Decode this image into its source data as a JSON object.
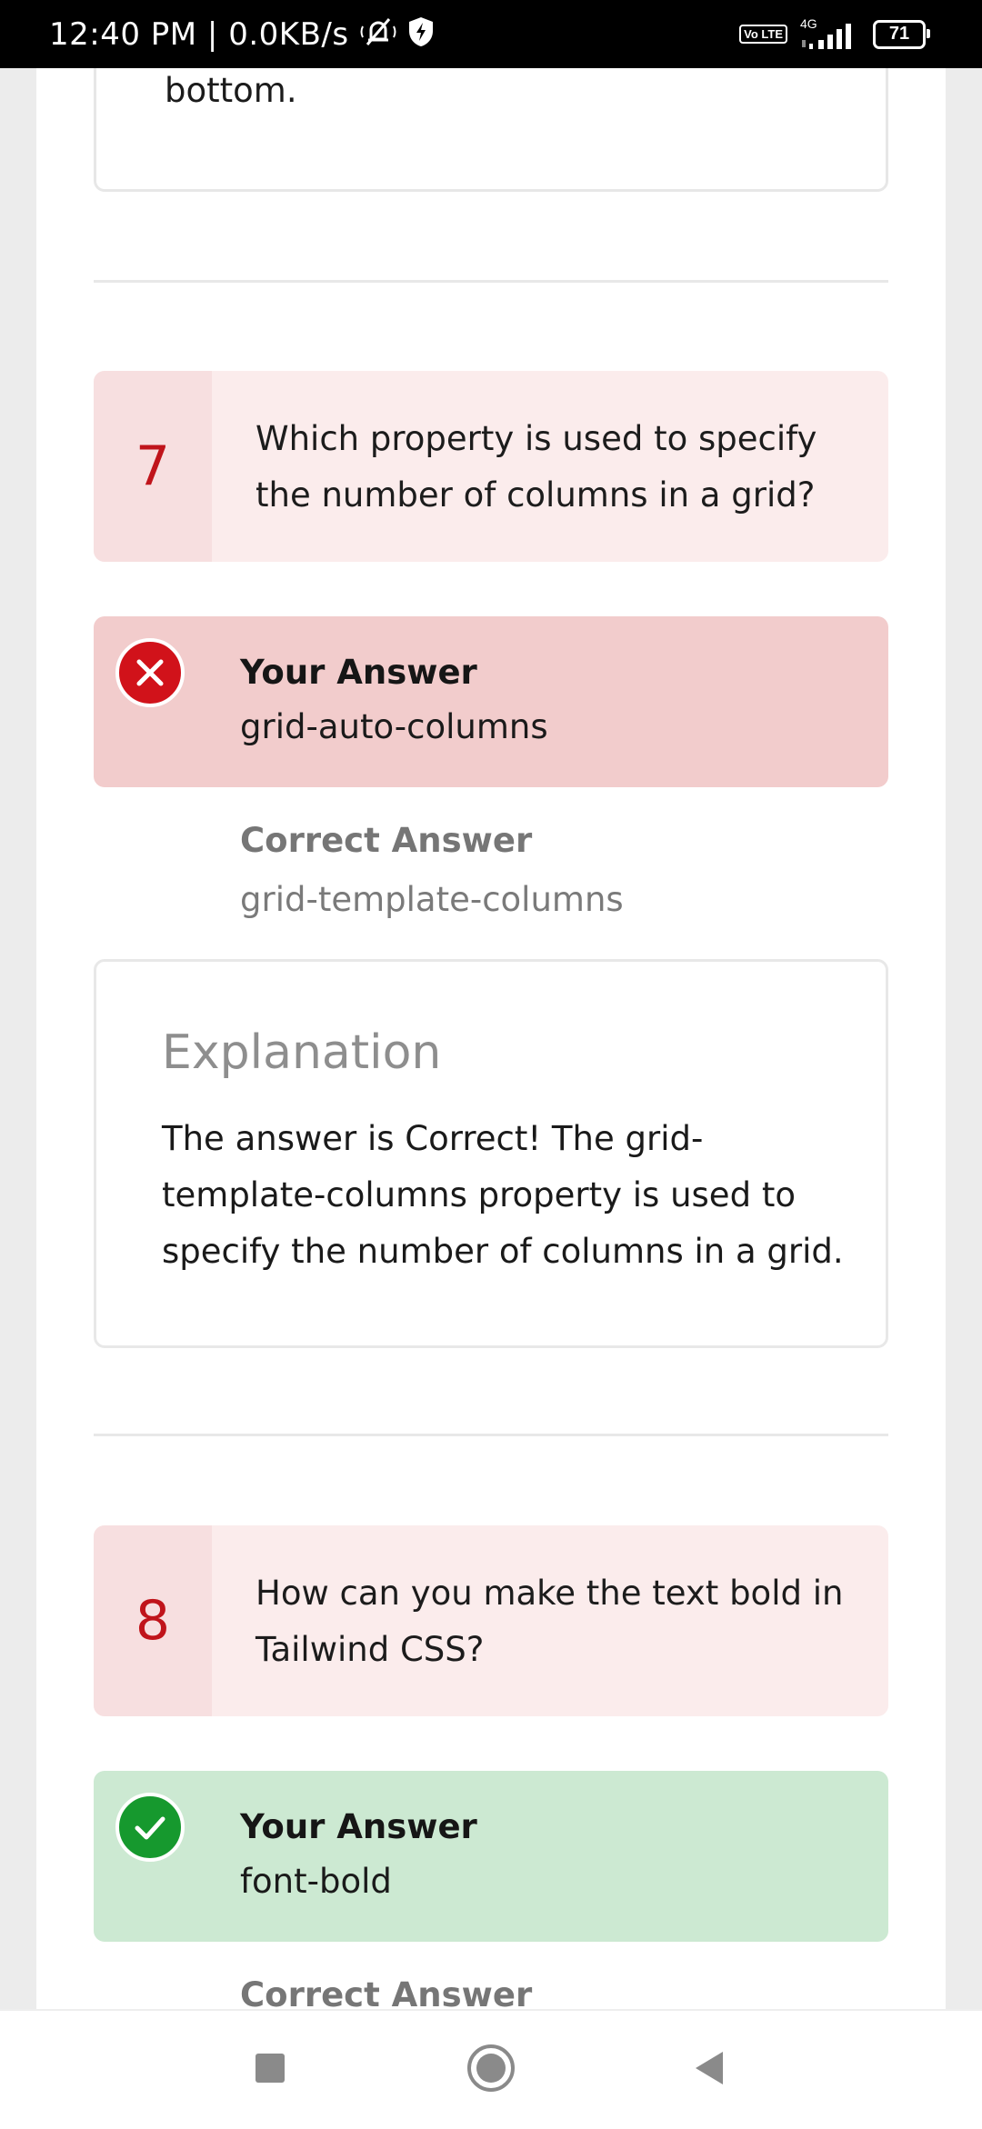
{
  "status_bar": {
    "time": "12:40 PM | 0.0KB/s",
    "network_type": "4G",
    "volte": "Vo LTE",
    "battery": "71"
  },
  "previous_card": {
    "text_tail": "bottom."
  },
  "questions": [
    {
      "number": "7",
      "question": "Which property is used to specify the number of columns in a grid?",
      "your_answer_label": "Your Answer",
      "your_answer": "grid-auto-columns",
      "result": "incorrect",
      "correct_answer_label": "Correct Answer",
      "correct_answer": "grid-template-columns",
      "explanation_title": "Explanation",
      "explanation": "The answer is Correct! The grid-template-columns property is used to specify the number of columns in a grid."
    },
    {
      "number": "8",
      "question": "How can you make the text bold in Tailwind CSS?",
      "your_answer_label": "Your Answer",
      "your_answer": "font-bold",
      "result": "correct",
      "correct_answer_label": "Correct Answer"
    }
  ],
  "colors": {
    "question_bg": "#fbecec",
    "question_number": "#c0141b",
    "wrong_bg": "#f2cccc",
    "wrong_icon": "#d1121a",
    "right_bg": "#cce9d2",
    "right_icon": "#16992e"
  },
  "nav": {
    "recents": "recents-square-icon",
    "home": "home-circle-icon",
    "back": "back-triangle-icon"
  }
}
